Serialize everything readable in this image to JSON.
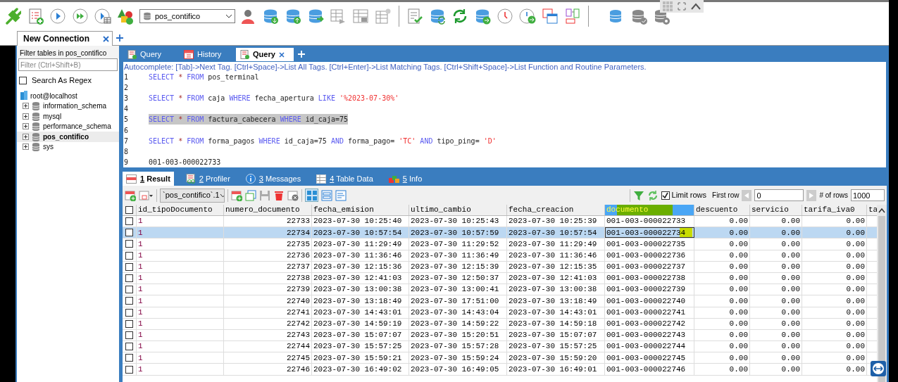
{
  "toolbar": {
    "database_select": "pos_contifico"
  },
  "connection_tabs": [
    {
      "label": "New Connection",
      "selected": true
    }
  ],
  "sidebar": {
    "filter_label": "Filter tables in pos_contifico",
    "filter_placeholder": "Filter (Ctrl+Shift+B)",
    "regex_option": {
      "label": "Search As Regex",
      "checked": false
    },
    "host": "root@localhost",
    "items": [
      {
        "name": "information_schema",
        "selected": false,
        "expanded": false
      },
      {
        "name": "mysql",
        "selected": false,
        "expanded": false
      },
      {
        "name": "performance_schema",
        "selected": false,
        "expanded": false
      },
      {
        "name": "pos_contifico",
        "selected": true,
        "expanded": false
      },
      {
        "name": "sys",
        "selected": false,
        "expanded": false
      }
    ]
  },
  "query_tabs": [
    {
      "label": "Query",
      "kind": "query",
      "selected": false
    },
    {
      "label": "History",
      "kind": "history",
      "selected": false
    },
    {
      "label": "Query",
      "kind": "query",
      "selected": true
    }
  ],
  "editor": {
    "hint": "Autocomplete: [Tab]->Next Tag. [Ctrl+Space]->List All Tags. [Ctrl+Enter]->List Matching Tags. [Ctrl+Shift+Space]->List Function and Routine Parameters.",
    "lines": [
      {
        "number": "1",
        "highlighted": false,
        "tokens": [
          {
            "kind": "keyword",
            "text": "SELECT"
          },
          {
            "kind": "operator",
            "text": "*"
          },
          {
            "kind": "keyword",
            "text": "FROM"
          },
          {
            "kind": "plain",
            "text": "pos_terminal"
          }
        ]
      },
      {
        "number": "2"
      },
      {
        "number": "3",
        "highlighted": false,
        "tokens": [
          {
            "kind": "keyword",
            "text": "SELECT"
          },
          {
            "kind": "operator",
            "text": "*"
          },
          {
            "kind": "keyword",
            "text": "FROM"
          },
          {
            "kind": "plain",
            "text": "caja"
          },
          {
            "kind": "keyword",
            "text": "WHERE"
          },
          {
            "kind": "plain",
            "text": "fecha_apertura"
          },
          {
            "kind": "keyword",
            "text": "LIKE"
          },
          {
            "kind": "string",
            "text": "'%2023-07-30%'"
          }
        ]
      },
      {
        "number": "4"
      },
      {
        "number": "5",
        "highlighted": true,
        "tokens": [
          {
            "kind": "keyword",
            "text": "SELECT"
          },
          {
            "kind": "operator",
            "text": "*"
          },
          {
            "kind": "keyword",
            "text": "FROM"
          },
          {
            "kind": "plain",
            "text": "factura_cabecera"
          },
          {
            "kind": "keyword",
            "text": "WHERE"
          },
          {
            "kind": "plain",
            "text": "id_caja=75"
          }
        ]
      },
      {
        "number": "6"
      },
      {
        "number": "7",
        "highlighted": false,
        "tokens": [
          {
            "kind": "keyword",
            "text": "SELECT"
          },
          {
            "kind": "operator",
            "text": "*"
          },
          {
            "kind": "keyword",
            "text": "FROM"
          },
          {
            "kind": "plain",
            "text": "forma_pagos"
          },
          {
            "kind": "keyword",
            "text": "WHERE"
          },
          {
            "kind": "plain",
            "text": "id_caja=75"
          },
          {
            "kind": "keyword",
            "text": "AND"
          },
          {
            "kind": "plain",
            "text": "forma_pago="
          },
          {
            "kind": "string",
            "text": "'TC'"
          },
          {
            "kind": "keyword",
            "text": "AND"
          },
          {
            "kind": "plain",
            "text": "tipo_ping="
          },
          {
            "kind": "string",
            "text": "'D'"
          }
        ]
      },
      {
        "number": "8"
      },
      {
        "number": "9",
        "highlighted": false,
        "tokens": [
          {
            "kind": "plain",
            "text": "001-003-000022733"
          }
        ]
      }
    ]
  },
  "result_tabs": [
    {
      "number": "1",
      "label": "Result",
      "kind": "result",
      "selected": true
    },
    {
      "number": "2",
      "label": "Profiler",
      "kind": "profiler",
      "selected": false
    },
    {
      "number": "3",
      "label": "Messages",
      "kind": "messages",
      "selected": false
    },
    {
      "number": "4",
      "label": "Table Data",
      "kind": "table",
      "selected": false
    },
    {
      "number": "5",
      "label": "Info",
      "kind": "info",
      "selected": false
    }
  ],
  "result_toolbar": {
    "table_select": "`pos_contifico`.1",
    "limit_rows": {
      "label": "Limit rows",
      "checked": true
    },
    "first_row_label": "First row",
    "first_row": "0",
    "rows_label": "# of rows",
    "rows": "1000"
  },
  "table": {
    "header_checked": false,
    "columns": [
      "id_tipoDocumento",
      "numero_documento",
      "fecha_emision",
      "ultimo_cambio",
      "fecha_creacion",
      "documento",
      "descuento",
      "servicio",
      "tarifa_iva0",
      "ta"
    ],
    "rows": [
      {
        "selected": false,
        "checked": false,
        "cells": [
          "1",
          "22733",
          "2023-07-30 10:25:40",
          "2023-07-30 10:25:43",
          "2023-07-30 10:25:39",
          "001-003-000022733",
          "0.00",
          "0.00",
          "0.00"
        ]
      },
      {
        "selected": true,
        "checked": false,
        "cells": [
          "1",
          "22734",
          "2023-07-30 10:57:54",
          "2023-07-30 10:57:59",
          "2023-07-30 10:57:54",
          "001-003-000022734",
          "0.00",
          "0.00",
          "0.00"
        ]
      },
      {
        "selected": false,
        "checked": false,
        "cells": [
          "1",
          "22735",
          "2023-07-30 11:29:49",
          "2023-07-30 11:29:52",
          "2023-07-30 11:29:49",
          "001-003-000022735",
          "0.00",
          "0.00",
          "0.00"
        ]
      },
      {
        "selected": false,
        "checked": false,
        "cells": [
          "1",
          "22736",
          "2023-07-30 11:36:46",
          "2023-07-30 11:36:49",
          "2023-07-30 11:36:46",
          "001-003-000022736",
          "0.00",
          "0.00",
          "0.00"
        ]
      },
      {
        "selected": false,
        "checked": false,
        "cells": [
          "1",
          "22737",
          "2023-07-30 12:15:36",
          "2023-07-30 12:15:39",
          "2023-07-30 12:15:35",
          "001-003-000022737",
          "0.00",
          "0.00",
          "0.00"
        ]
      },
      {
        "selected": false,
        "checked": false,
        "cells": [
          "1",
          "22738",
          "2023-07-30 12:41:03",
          "2023-07-30 12:50:37",
          "2023-07-30 12:41:03",
          "001-003-000022738",
          "0.00",
          "0.00",
          "0.00"
        ]
      },
      {
        "selected": false,
        "checked": false,
        "cells": [
          "1",
          "22739",
          "2023-07-30 13:00:38",
          "2023-07-30 13:00:41",
          "2023-07-30 13:00:38",
          "001-003-000022739",
          "0.00",
          "0.00",
          "0.00"
        ]
      },
      {
        "selected": false,
        "checked": false,
        "cells": [
          "1",
          "22740",
          "2023-07-30 13:18:49",
          "2023-07-30 17:51:00",
          "2023-07-30 13:18:49",
          "001-003-000022740",
          "0.00",
          "0.00",
          "0.00"
        ]
      },
      {
        "selected": false,
        "checked": false,
        "cells": [
          "1",
          "22741",
          "2023-07-30 14:43:01",
          "2023-07-30 14:43:04",
          "2023-07-30 14:43:01",
          "001-003-000022741",
          "0.00",
          "0.00",
          "0.00"
        ]
      },
      {
        "selected": false,
        "checked": false,
        "cells": [
          "1",
          "22742",
          "2023-07-30 14:59:19",
          "2023-07-30 14:59:22",
          "2023-07-30 14:59:18",
          "001-003-000022742",
          "0.00",
          "0.00",
          "0.00"
        ]
      },
      {
        "selected": false,
        "checked": false,
        "cells": [
          "1",
          "22743",
          "2023-07-30 15:07:07",
          "2023-07-30 15:20:51",
          "2023-07-30 15:07:07",
          "001-003-000022743",
          "0.00",
          "0.00",
          "0.00"
        ]
      },
      {
        "selected": false,
        "checked": false,
        "cells": [
          "1",
          "22744",
          "2023-07-30 15:57:25",
          "2023-07-30 15:57:28",
          "2023-07-30 15:57:25",
          "001-003-000022744",
          "0.00",
          "0.00",
          "0.00"
        ]
      },
      {
        "selected": false,
        "checked": false,
        "cells": [
          "1",
          "22745",
          "2023-07-30 15:59:21",
          "2023-07-30 15:59:24",
          "2023-07-30 15:59:20",
          "001-003-000022745",
          "0.00",
          "0.00",
          "0.00"
        ]
      },
      {
        "selected": false,
        "checked": false,
        "cells": [
          "1",
          "22746",
          "2023-07-30 16:49:02",
          "2023-07-30 16:49:05",
          "2023-07-30 16:49:01",
          "001-003-000022746",
          "0.00",
          "0.00",
          "0.00"
        ]
      }
    ]
  }
}
